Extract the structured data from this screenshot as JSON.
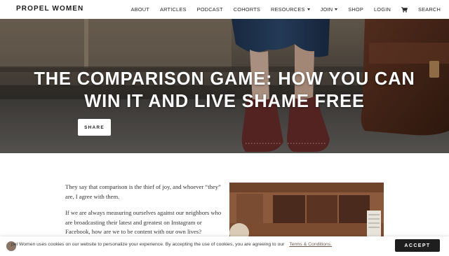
{
  "header": {
    "logo": "PROPEL WOMEN",
    "nav": [
      {
        "label": "ABOUT"
      },
      {
        "label": "ARTICLES"
      },
      {
        "label": "PODCAST"
      },
      {
        "label": "COHORTS"
      },
      {
        "label": "RESOURCES"
      },
      {
        "label": "JOIN"
      },
      {
        "label": "SHOP"
      },
      {
        "label": "LOGIN"
      },
      {
        "label": "SEARCH"
      }
    ]
  },
  "hero": {
    "title": "THE COMPARISON GAME: HOW YOU CAN WIN IT AND LIVE SHAME FREE",
    "share_label": "SHARE"
  },
  "article": {
    "paragraphs": [
      "They say that comparison is the thief of joy, and whoever “they” are, I agree with them.",
      "If we are always measuring ourselves against our neighbors who are broadcasting their latest and greatest on Instagram or Facebook, how are we to be content with our own lives?"
    ]
  },
  "cookie_bar": {
    "text": "pel Women uses cookies on our website to personalize your experience. By accepting the use of cookies, you are agreeing to our",
    "link": "Terms & Conditions.",
    "accept_label": "ACCEPT"
  },
  "colors": {
    "accent_dark": "#1e1e1e",
    "link_brown": "#6b5a4e",
    "hero_overlay": "#3a3634"
  },
  "icons": [
    "shopping-cart-icon",
    "chevron-down-icon",
    "propel-logo-icon"
  ]
}
